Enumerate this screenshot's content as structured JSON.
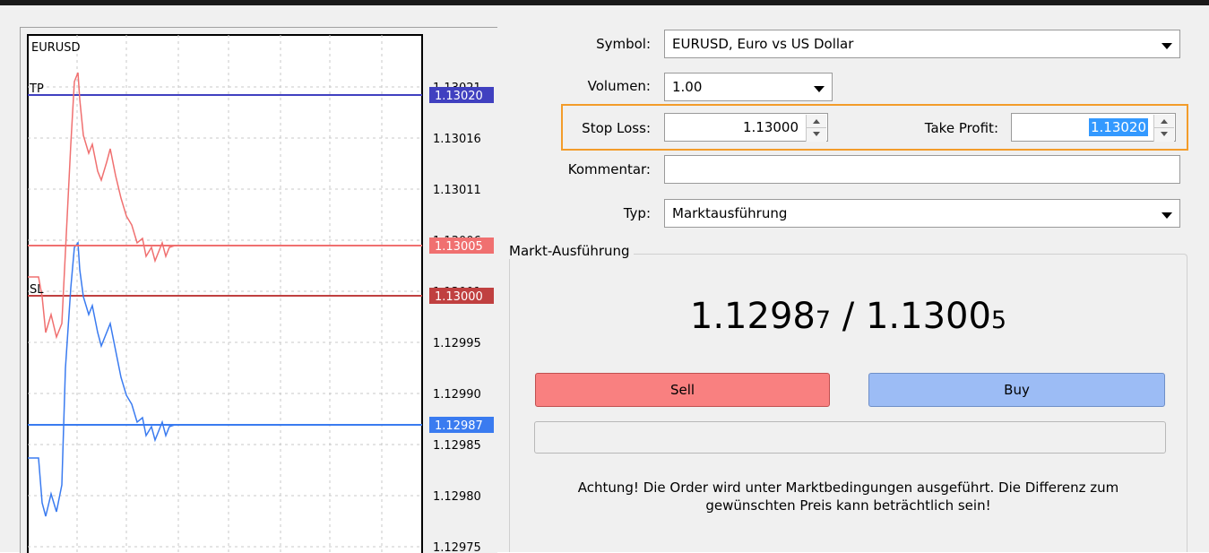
{
  "chart": {
    "symbol_label": "EURUSD",
    "tp_label": "TP",
    "sl_label": "SL",
    "price_ticks": [
      "1.13021",
      "1.13016",
      "1.13011",
      "1.13006",
      "1.13001",
      "1.12995",
      "1.12990",
      "1.12985",
      "1.12980",
      "1.12975"
    ],
    "markers": {
      "tp": "1.13020",
      "ask": "1.13005",
      "sl": "1.13000",
      "bid": "1.12987"
    },
    "colors": {
      "tp_line": "#4040c0",
      "sl_line": "#c04040",
      "ask_line": "#f07070",
      "bid_line": "#3a7bf0",
      "grid": "#c8c8c8"
    }
  },
  "form": {
    "symbol_label": "Symbol:",
    "symbol_value": "EURUSD, Euro vs US Dollar",
    "volume_label": "Volumen:",
    "volume_value": "1.00",
    "stop_loss_label": "Stop Loss:",
    "stop_loss_value": "1.13000",
    "take_profit_label": "Take Profit:",
    "take_profit_value": "1.13020",
    "comment_label": "Kommentar:",
    "comment_value": "",
    "type_label": "Typ:",
    "type_value": "Marktausführung",
    "highlight_color": "#f39c2a"
  },
  "execution": {
    "group_title": "Markt-Ausführung",
    "bid_main": "1.1298",
    "bid_small": "7",
    "separator": " / ",
    "ask_main": "1.1300",
    "ask_small": "5",
    "sell_label": "Sell",
    "buy_label": "Buy",
    "warning_line1": "Achtung! Die Order wird unter Marktbedingungen ausgeführt. Die Differenz zum",
    "warning_line2": "gewünschten Preis kann beträchtlich sein!",
    "sell_color": "#f98080",
    "buy_color": "#9cbcf5"
  }
}
